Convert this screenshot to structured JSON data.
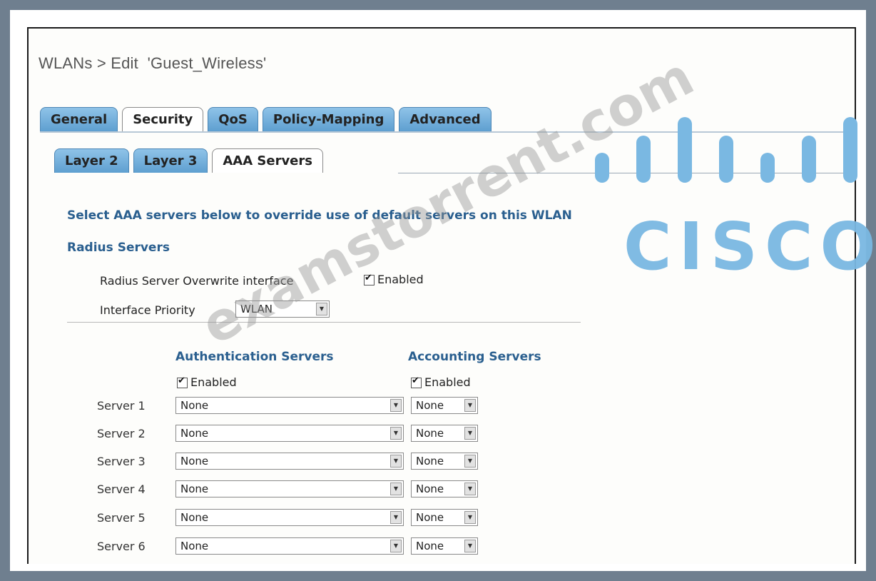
{
  "page": {
    "title": "WLANs > Edit  'Guest_Wireless'"
  },
  "tabs": {
    "main": [
      {
        "label": "General",
        "active": false
      },
      {
        "label": "Security",
        "active": true
      },
      {
        "label": "QoS",
        "active": false
      },
      {
        "label": "Policy-Mapping",
        "active": false
      },
      {
        "label": "Advanced",
        "active": false
      }
    ],
    "sub": [
      {
        "label": "Layer 2",
        "active": false
      },
      {
        "label": "Layer 3",
        "active": false
      },
      {
        "label": "AAA Servers",
        "active": true
      }
    ]
  },
  "content": {
    "intro": "Select AAA servers below to override use of default servers on this WLAN",
    "radius_heading": "Radius Servers",
    "overwrite_label": "Radius Server Overwrite interface",
    "overwrite_checkbox": "Enabled",
    "priority_label": "Interface Priority",
    "priority_value": "WLAN",
    "auth_heading": "Authentication Servers",
    "acct_heading": "Accounting Servers",
    "auth_enabled": "Enabled",
    "acct_enabled": "Enabled",
    "servers": [
      {
        "label": "Server 1",
        "auth": "None",
        "acct": "None"
      },
      {
        "label": "Server 2",
        "auth": "None",
        "acct": "None"
      },
      {
        "label": "Server 3",
        "auth": "None",
        "acct": "None"
      },
      {
        "label": "Server 4",
        "auth": "None",
        "acct": "None"
      },
      {
        "label": "Server 5",
        "auth": "None",
        "acct": "None"
      },
      {
        "label": "Server 6",
        "auth": "None",
        "acct": "None"
      }
    ]
  },
  "overlay": {
    "logo_text": "CISCO",
    "watermark": "examstorrent.com"
  },
  "colors": {
    "tab_blue": "#5e9fd0",
    "heading_blue": "#2a5f8f",
    "logo_blue": "#7ab8e2",
    "background": "#6f7f8f"
  },
  "icons": {
    "dropdown": "chevron-down-icon",
    "checkbox": "checkbox-checked-icon"
  }
}
